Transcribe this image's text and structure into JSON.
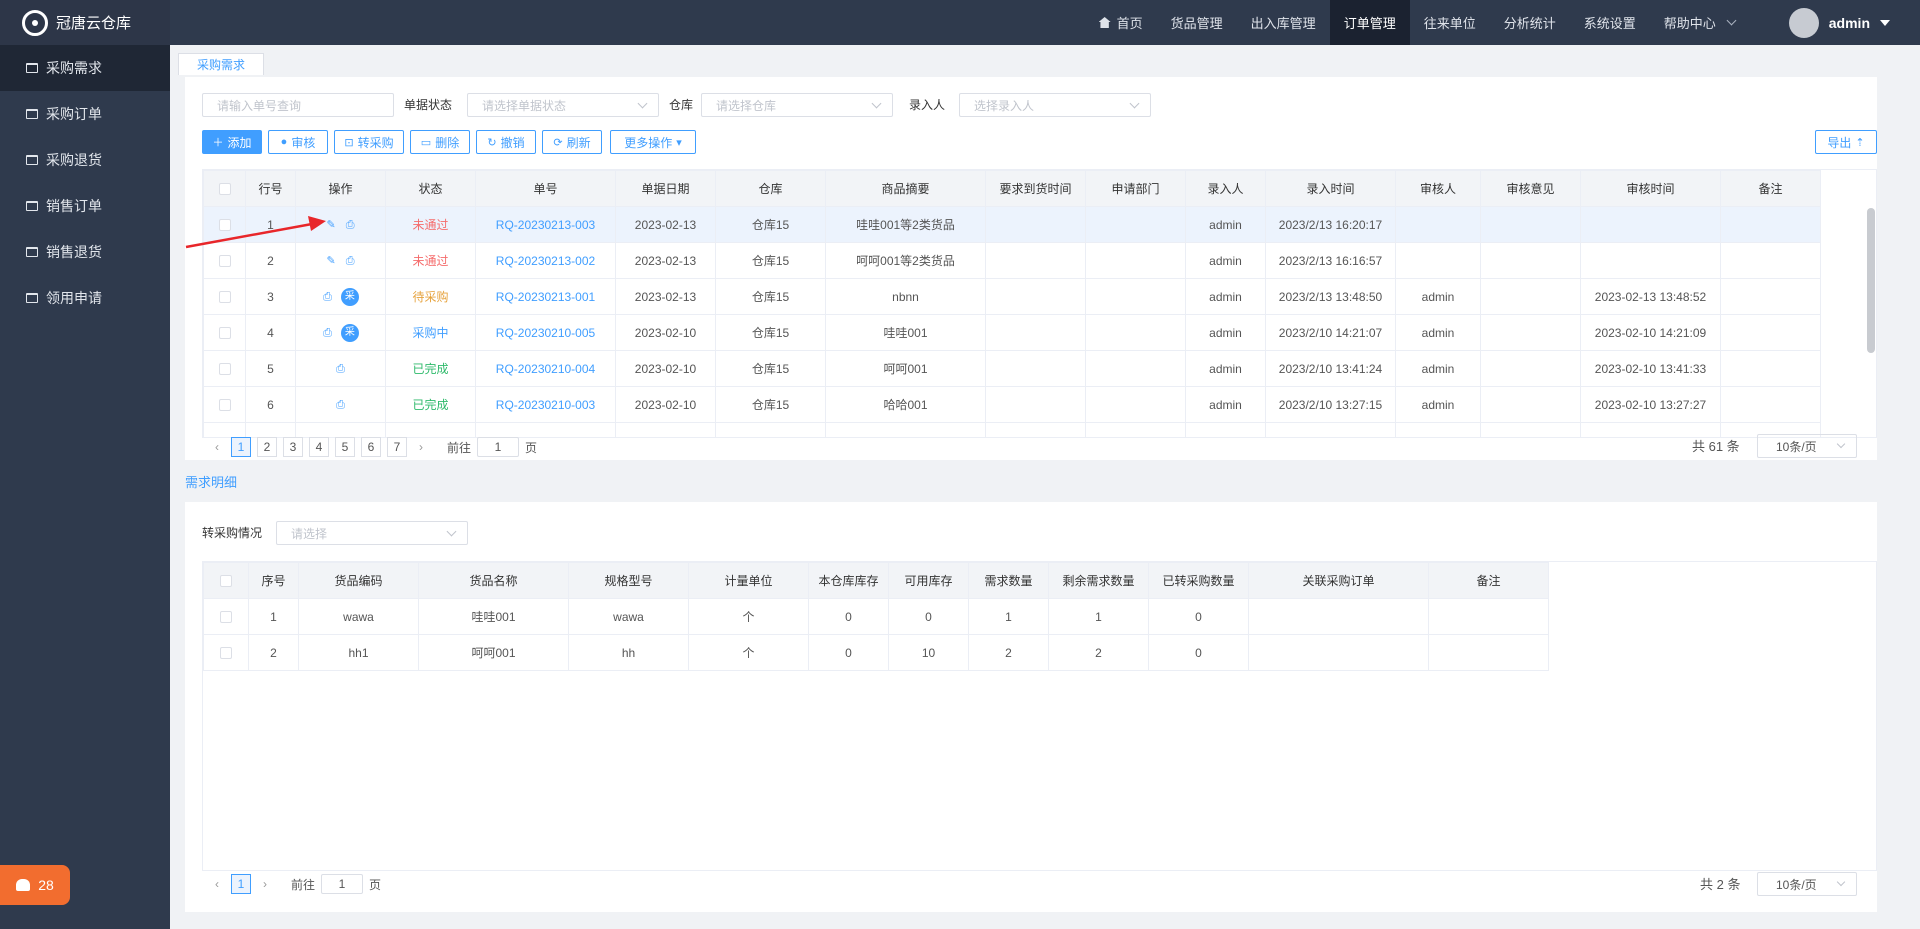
{
  "app": {
    "logo_text": "冠唐云仓库",
    "alarm_count": "28"
  },
  "sidebar": {
    "items": [
      {
        "label": "采购需求",
        "active": true
      },
      {
        "label": "采购订单"
      },
      {
        "label": "采购退货"
      },
      {
        "label": "销售订单"
      },
      {
        "label": "销售退货"
      },
      {
        "label": "领用申请"
      }
    ]
  },
  "topnav": {
    "items": [
      {
        "label": "首页"
      },
      {
        "label": "货品管理"
      },
      {
        "label": "出入库管理"
      },
      {
        "label": "订单管理",
        "active": true
      },
      {
        "label": "往来单位"
      },
      {
        "label": "分析统计"
      },
      {
        "label": "系统设置"
      },
      {
        "label": "帮助中心"
      }
    ],
    "user": "admin"
  },
  "tab": {
    "label": "采购需求"
  },
  "filters": {
    "order_placeholder": "请输入单号查询",
    "status_label": "单据状态",
    "status_placeholder": "请选择单据状态",
    "warehouse_label": "仓库",
    "warehouse_placeholder": "请选择仓库",
    "entry_label": "录入人",
    "entry_placeholder": "选择录入人"
  },
  "toolbar": {
    "add": "添加",
    "audit": "审核",
    "to_purchase": "转采购",
    "delete": "删除",
    "revoke": "撤销",
    "refresh": "刷新",
    "more": "更多操作",
    "export": "导出"
  },
  "table1": {
    "headers": [
      "行号",
      "操作",
      "状态",
      "单号",
      "单据日期",
      "仓库",
      "商品摘要",
      "要求到货时间",
      "申请部门",
      "录入人",
      "录入时间",
      "审核人",
      "审核意见",
      "审核时间",
      "备注"
    ],
    "rows": [
      {
        "no": "1",
        "status": "未通过",
        "status_class": "st-red",
        "order": "RQ-20230213-003",
        "date": "2023-02-13",
        "wh": "仓库15",
        "summary": "哇哇001等2类货品",
        "arrive": "",
        "dept": "",
        "entry": "admin",
        "entry_time": "2023/2/13 16:20:17",
        "auditor": "",
        "opinion": "",
        "audit_time": "",
        "remark": ""
      },
      {
        "no": "2",
        "status": "未通过",
        "status_class": "st-red",
        "order": "RQ-20230213-002",
        "date": "2023-02-13",
        "wh": "仓库15",
        "summary": "呵呵001等2类货品",
        "arrive": "",
        "dept": "",
        "entry": "admin",
        "entry_time": "2023/2/13 16:16:57",
        "auditor": "",
        "opinion": "",
        "audit_time": "",
        "remark": ""
      },
      {
        "no": "3",
        "status": "待采购",
        "status_class": "st-orange",
        "order": "RQ-20230213-001",
        "date": "2023-02-13",
        "wh": "仓库15",
        "summary": "nbnn",
        "arrive": "",
        "dept": "",
        "entry": "admin",
        "entry_time": "2023/2/13 13:48:50",
        "auditor": "admin",
        "opinion": "",
        "audit_time": "2023-02-13 13:48:52",
        "remark": ""
      },
      {
        "no": "4",
        "status": "采购中",
        "status_class": "st-blue",
        "order": "RQ-20230210-005",
        "date": "2023-02-10",
        "wh": "仓库15",
        "summary": "哇哇001",
        "arrive": "",
        "dept": "",
        "entry": "admin",
        "entry_time": "2023/2/10 14:21:07",
        "auditor": "admin",
        "opinion": "",
        "audit_time": "2023-02-10 14:21:09",
        "remark": ""
      },
      {
        "no": "5",
        "status": "已完成",
        "status_class": "st-green",
        "order": "RQ-20230210-004",
        "date": "2023-02-10",
        "wh": "仓库15",
        "summary": "呵呵001",
        "arrive": "",
        "dept": "",
        "entry": "admin",
        "entry_time": "2023/2/10 13:41:24",
        "auditor": "admin",
        "opinion": "",
        "audit_time": "2023-02-10 13:41:33",
        "remark": ""
      },
      {
        "no": "6",
        "status": "已完成",
        "status_class": "st-green",
        "order": "RQ-20230210-003",
        "date": "2023-02-10",
        "wh": "仓库15",
        "summary": "哈哈001",
        "arrive": "",
        "dept": "",
        "entry": "admin",
        "entry_time": "2023/2/10 13:27:15",
        "auditor": "admin",
        "opinion": "",
        "audit_time": "2023-02-10 13:27:27",
        "remark": ""
      }
    ]
  },
  "op_cai": "采",
  "pager1": {
    "pages": [
      "1",
      "2",
      "3",
      "4",
      "5",
      "6",
      "7"
    ],
    "goto_label": "前往",
    "goto_value": "1",
    "page_unit": "页",
    "total": "共 61 条",
    "size": "10条/页"
  },
  "detail": {
    "section_title": "需求明细",
    "filter_label": "转采购情况",
    "filter_placeholder": "请选择",
    "headers": [
      "序号",
      "货品编码",
      "货品名称",
      "规格型号",
      "计量单位",
      "本仓库库存",
      "可用库存",
      "需求数量",
      "剩余需求数量",
      "已转采购数量",
      "关联采购订单",
      "备注"
    ],
    "rows": [
      {
        "no": "1",
        "code": "wawa",
        "name": "哇哇001",
        "spec": "wawa",
        "unit": "个",
        "stock": "0",
        "avail": "0",
        "need": "1",
        "remain": "1",
        "converted": "0",
        "order": "",
        "remark": ""
      },
      {
        "no": "2",
        "code": "hh1",
        "name": "呵呵001",
        "spec": "hh",
        "unit": "个",
        "stock": "0",
        "avail": "10",
        "need": "2",
        "remain": "2",
        "converted": "0",
        "order": "",
        "remark": ""
      }
    ]
  },
  "pager2": {
    "pages": [
      "1"
    ],
    "goto_label": "前往",
    "goto_value": "1",
    "page_unit": "页",
    "total": "共 2 条",
    "size": "10条/页"
  },
  "colors": {
    "accent": "#409eff",
    "sidebar": "#2f3a4d",
    "alarm": "#f26d2f",
    "annotation_arrow": "#e8262a"
  }
}
